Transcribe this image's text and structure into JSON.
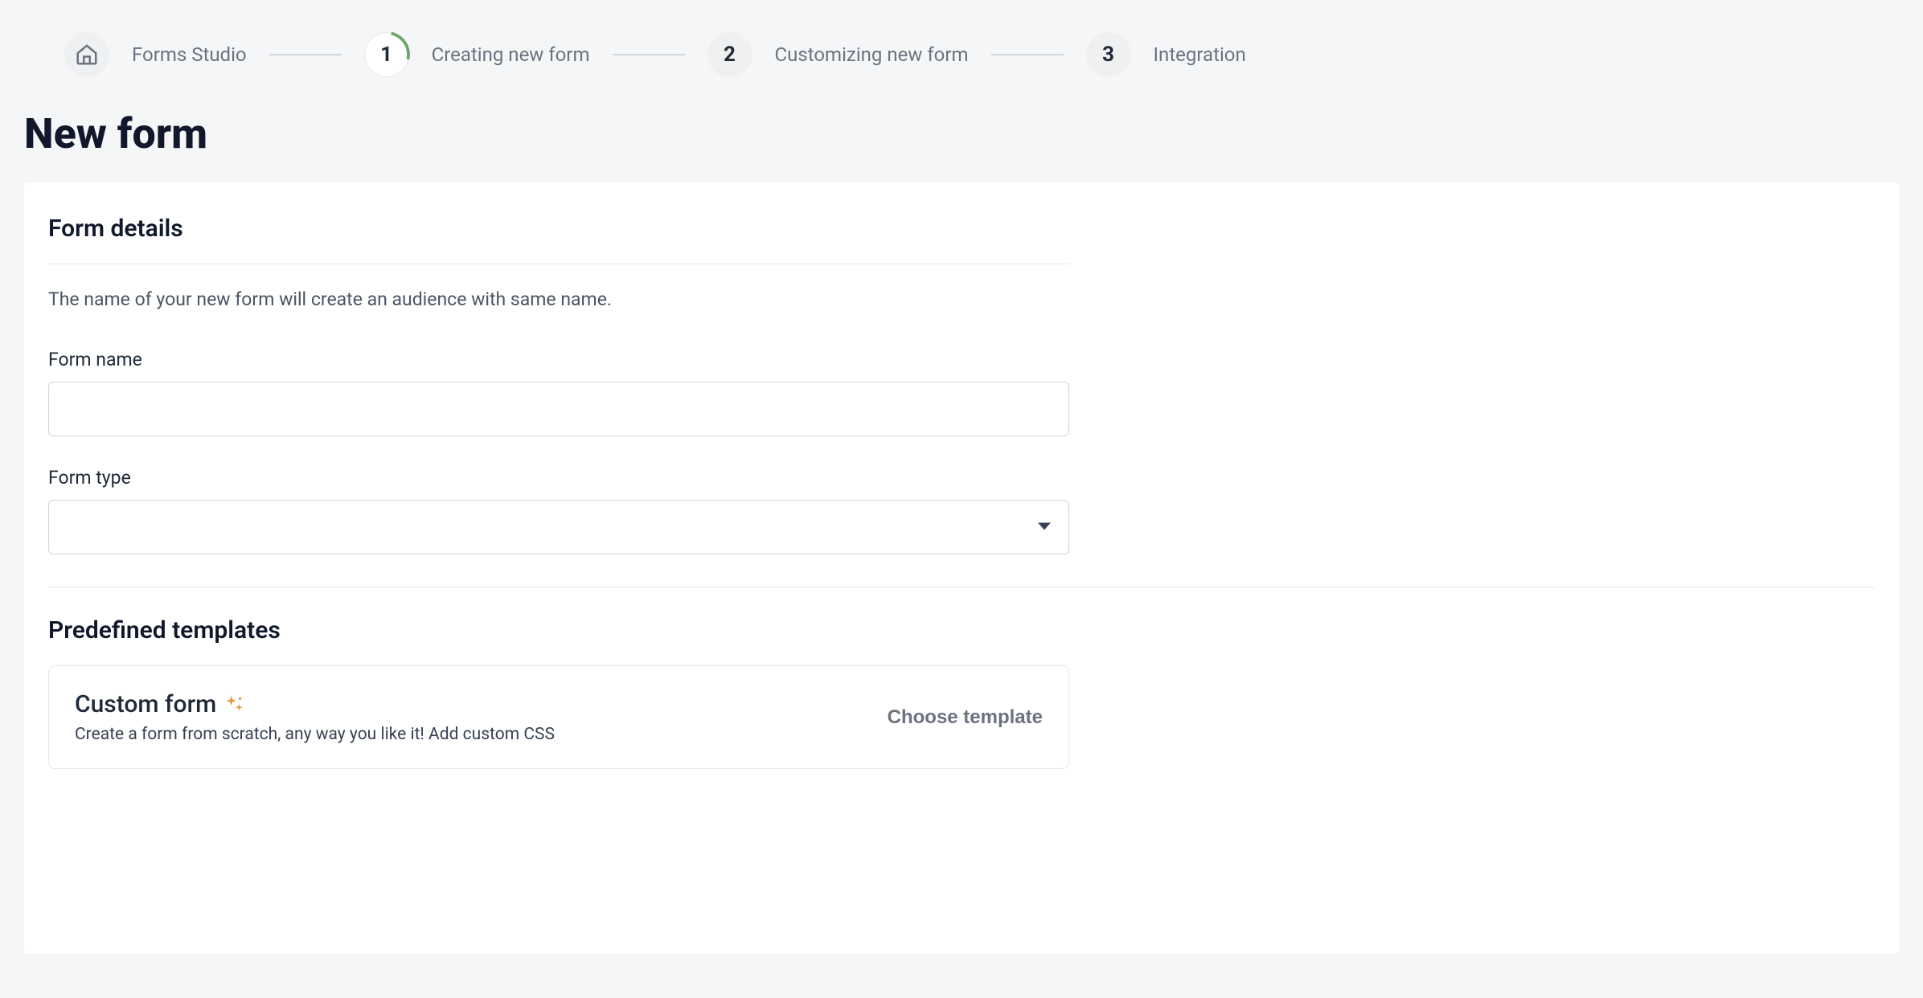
{
  "stepper": {
    "home_label": "Forms Studio",
    "steps": [
      {
        "num": "1",
        "label": "Creating new form"
      },
      {
        "num": "2",
        "label": "Customizing new form"
      },
      {
        "num": "3",
        "label": "Integration"
      }
    ]
  },
  "page": {
    "title": "New form"
  },
  "form_details": {
    "heading": "Form details",
    "description": "The name of your new form will create an audience with same name.",
    "name_label": "Form name",
    "name_value": "",
    "type_label": "Form type",
    "type_value": ""
  },
  "templates": {
    "heading": "Predefined templates",
    "items": [
      {
        "title": "Custom form",
        "description": "Create a form from scratch, any way you like it! Add custom CSS",
        "action": "Choose template"
      }
    ]
  }
}
